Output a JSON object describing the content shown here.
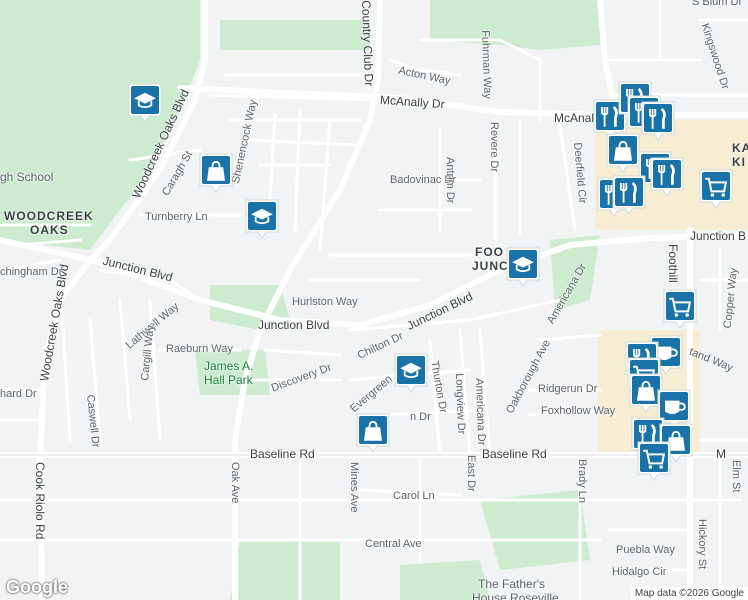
{
  "streets": {
    "country_club": "Country Club Dr",
    "acton": "Acton Way",
    "fuhrman": "Fuhrman Way",
    "mcanally": "McAnally Dr",
    "mcanally2": "McAnall",
    "woodcreek_oaks_blvd": "Woodcreek Oaks Blvd",
    "woodcreek_oaks_blvd2": "Woodcreek Oaks Blvd",
    "caragh": "Caragh St",
    "shenencock": "Shenencock Way",
    "badovinac": "Badovinac Dr",
    "antrim": "Antrim Dr",
    "revere": "Revere Dr",
    "deerfield": "Deerfield Cir",
    "kingswood": "Kingswood Dr",
    "blum": "S Blum Dr",
    "turnberry": "Turnberry Ln",
    "junction_w": "Junction Blvd",
    "junction_c": "Junction Blvd",
    "junction_e": "Junction Blvd",
    "junction_far": "Junction B",
    "chingham": "chingham Dr",
    "hurlston": "Hurlston Way",
    "lathwell": "Lathwell Way",
    "raeburn": "Raeburn Way",
    "chilton": "Chilton Dr",
    "discovery": "Discovery Dr",
    "evergreen": "Evergreen",
    "thurton": "Thurton Dr",
    "longview": "Longview Dr",
    "americana": "Americana Dr",
    "americana2": "Americana Dr",
    "oakborough": "Oakborough Ave",
    "ridgerun": "Ridgerun Dr",
    "foxhollow": "Foxhollow Way",
    "n_dr": "n Dr",
    "hard": "hard Dr",
    "caswell": "Caswell Dr",
    "cargill": "Cargill Way",
    "baseline_w": "Baseline Rd",
    "baseline_e": "Baseline Rd",
    "oak": "Oak Ave",
    "mines": "Mines Ave",
    "east": "East Dr",
    "brady": "Brady Ln",
    "carol": "Carol Ln",
    "central": "Central Ave",
    "cook_riolo": "Cook Riolo Rd",
    "foothill": "Foothill",
    "copper": "Copper Way",
    "stand": "tand Way",
    "elm": "Elm St",
    "hickory": "Hickory St",
    "puebla": "Puebla Way",
    "hidalgo": "Hidalgo Cir",
    "m_letter": "M"
  },
  "areas": {
    "woodcreek_line1": "WOODCREEK",
    "woodcreek_line2": "OAKS",
    "foothills_line1": "FOO",
    "foothills_line2": "JUNC",
    "ka_line1": "KA",
    "ka_line2": "KI"
  },
  "places": {
    "school": "gh School",
    "park_line1": "James A.",
    "park_line2": "Hall Park",
    "church_line1": "The Father's",
    "church_line2": "House Roseville"
  },
  "pins": [
    {
      "icon": "school-icon"
    },
    {
      "icon": "shopping-bag-icon"
    },
    {
      "icon": "school-icon"
    },
    {
      "icon": "school-icon"
    },
    {
      "icon": "school-icon"
    },
    {
      "icon": "shopping-bag-icon"
    },
    {
      "icon": "restaurant-icon"
    },
    {
      "icon": "restaurant-icon"
    },
    {
      "icon": "restaurant-icon"
    },
    {
      "icon": "restaurant-icon"
    },
    {
      "icon": "shopping-bag-icon"
    },
    {
      "icon": "restaurant-icon"
    },
    {
      "icon": "restaurant-icon"
    },
    {
      "icon": "restaurant-icon"
    },
    {
      "icon": "restaurant-icon"
    },
    {
      "icon": "shopping-cart-icon"
    },
    {
      "icon": "shopping-cart-icon"
    },
    {
      "icon": "coffee-icon"
    },
    {
      "icon": "restaurant-icon"
    },
    {
      "icon": "shopping-cart-icon"
    },
    {
      "icon": "shopping-bag-icon"
    },
    {
      "icon": "coffee-icon"
    },
    {
      "icon": "restaurant-icon"
    },
    {
      "icon": "shopping-bag-icon"
    },
    {
      "icon": "shopping-cart-icon"
    }
  ],
  "footer": {
    "logo": "Google",
    "credit": "Map data ©2026 Google"
  },
  "colors": {
    "park_green": "#cdeccf",
    "pin_blue": "#1a73a8",
    "road_white": "#ffffff",
    "commercial": "#f7edd2"
  }
}
